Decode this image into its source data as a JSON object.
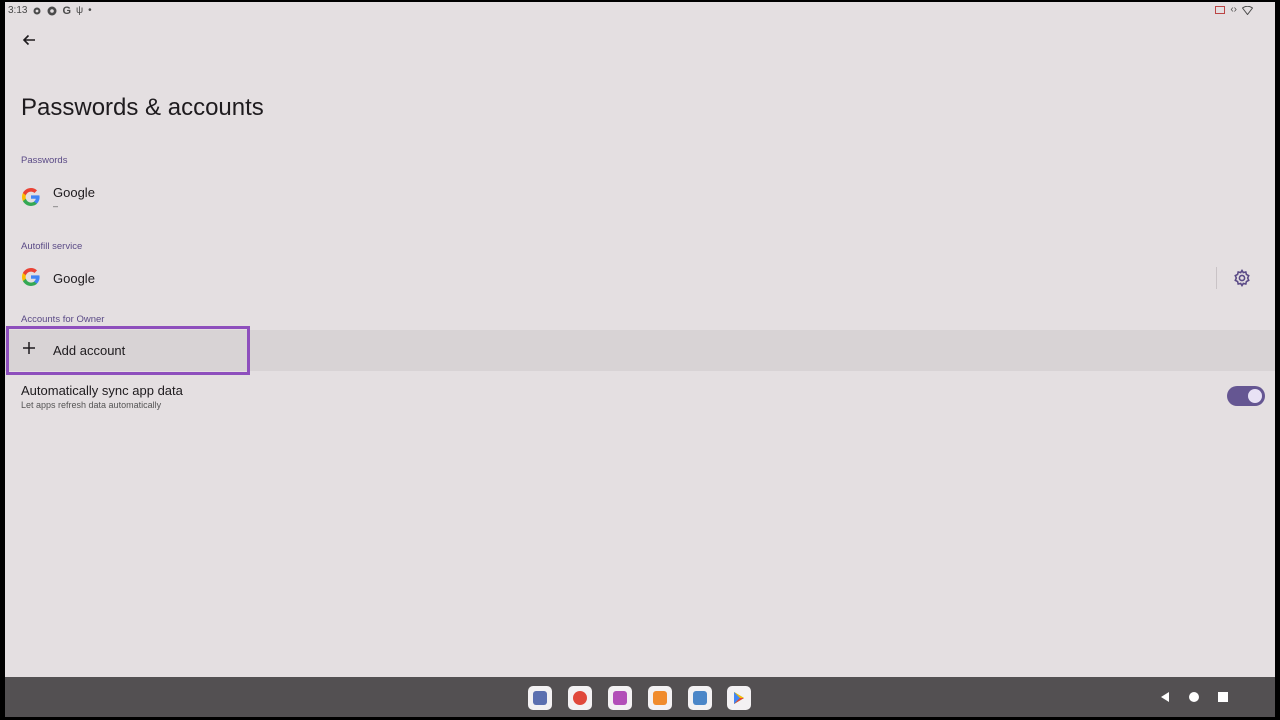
{
  "status_bar": {
    "time": "3:13",
    "left_icons": [
      "gear-icon",
      "chrome-icon",
      "google-g-icon",
      "usb-icon",
      "dot-icon"
    ],
    "right_icons": [
      "cast-icon",
      "code-icon",
      "wifi-icon"
    ]
  },
  "page": {
    "title": "Passwords & accounts"
  },
  "passwords": {
    "section_label": "Passwords",
    "provider_title": "Google",
    "provider_summary": "–"
  },
  "autofill": {
    "section_label": "Autofill service",
    "provider_title": "Google"
  },
  "accounts": {
    "section_label": "Accounts for Owner",
    "add_account_label": "Add account"
  },
  "sync": {
    "title": "Automatically sync app data",
    "summary": "Let apps refresh data automatically",
    "enabled": true
  },
  "colors": {
    "background": "#e4dfe1",
    "accent": "#655692",
    "section_label": "#5a4a86",
    "highlight": "#8e4fbd",
    "navbar": "#535052"
  },
  "dock": {
    "apps": [
      {
        "name": "app-1",
        "color": "#5b6fb0"
      },
      {
        "name": "app-2",
        "color": "#e0483b"
      },
      {
        "name": "app-3",
        "color": "#b24fb8"
      },
      {
        "name": "app-4",
        "color": "#f08b2c"
      },
      {
        "name": "app-5",
        "color": "#4b86c8"
      },
      {
        "name": "play-store",
        "color": "#34a853"
      }
    ]
  }
}
